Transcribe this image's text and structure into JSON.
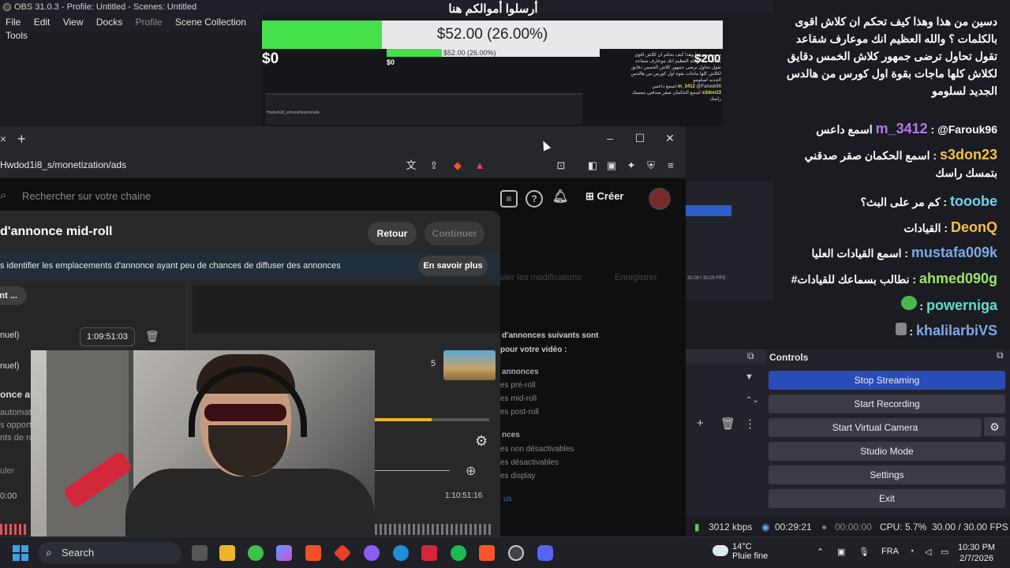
{
  "obs": {
    "title": "OBS 31.0.3 - Profile: Untitled - Scenes: Untitled",
    "menu": [
      "File",
      "Edit",
      "View",
      "Docks",
      "Profile",
      "Scene Collection",
      "Tools"
    ]
  },
  "donation": {
    "title": "أرسلوا أموالكم هنا",
    "goal_text": "$52.00 (26.00%)",
    "progress_pct": 26,
    "min_label": "$0",
    "max_label": "$200",
    "nested_goal_text": "$52.00 (26.00%)",
    "nested_min": "$0"
  },
  "browser": {
    "url": "Hwdod1i8_s/monetization/ads",
    "search_placeholder": "Rechercher sur votre chaine",
    "create_label": "Créer",
    "dialog_title": "d'annonce mid-roll",
    "back_button": "Retour",
    "continue_button": "Continuer",
    "info_text": "s identifier les emplacements d'annonce ayant peu de chances de diffuser des annonces",
    "learn_more": "En savoir plus",
    "left_rows": [
      "nt ...",
      "nuel)",
      "nuel)",
      "once au",
      "automat",
      "s opport",
      "nts de ru",
      "uler",
      "0:00"
    ],
    "time_value": "1:09:51:03",
    "thumb_number": "5",
    "time_end": "1:10:51:16",
    "side_text": [
      "d'annonces suivants sont",
      "pour votre vidéo :",
      "annonces",
      "es pré-roll",
      "es mid-roll",
      "es post-roll",
      "nces",
      "es non désactivables",
      "es désactivables",
      "es display",
      "us"
    ],
    "ghost_buttons": [
      "uler les modifications",
      "Enregistrer"
    ]
  },
  "chat": [
    {
      "text": "دسين من هذا وهذا كيف تحكم ان كلاش اقوى بالكلمات ؟ والله العظيم انك موعارف شقاعد تقول تحاول ترضى جمهور كلاش الخمس دقايق لكلاش كلها ماجات بقوة اول كورس من هالدس الجديد لسلومو",
      "user": "",
      "color": "#ffffff"
    },
    {
      "user": "m_3412",
      "text": "@Farouk96 اسمع داعس",
      "color": "#b07ae8"
    },
    {
      "user": "s3don23",
      "text": "اسمع الحكمان صقر صدقني بتمسك راسك",
      "color": "#f5c14a"
    },
    {
      "user": "tooobe",
      "text": "كم مر على البث؟",
      "color": "#6fd3e6"
    },
    {
      "user": "DeonQ",
      "text": "القيادات",
      "color": "#f5c14a"
    },
    {
      "user": "mustafa009k",
      "text": "اسمع القيادات العليا",
      "color": "#7fa8e8"
    },
    {
      "user": "ahmed090g",
      "text": "نطالب بسماعك للقيادات#",
      "color": "#9be36a"
    },
    {
      "user": "powerniga",
      "text": "",
      "color": "#5fe0c8"
    },
    {
      "user": "khalilarbiVS",
      "text": "",
      "color": "#7fa8e8"
    }
  ],
  "controls": {
    "title": "Controls",
    "buttons": [
      "Stop Streaming",
      "Start Recording",
      "Start Virtual Camera",
      "Studio Mode",
      "Settings",
      "Exit"
    ]
  },
  "status": {
    "bitrate": "3012 kbps",
    "stream_time": "00:29:21",
    "rec_time": "00:00:00",
    "cpu": "CPU: 5.7%",
    "fps": "30.00 / 30.00 FPS"
  },
  "taskbar": {
    "search": "Search",
    "temp": "14°C",
    "weather": "Pluie fine",
    "lang": "FRA",
    "time": "10:30 PM",
    "date": "2/7/2026"
  }
}
